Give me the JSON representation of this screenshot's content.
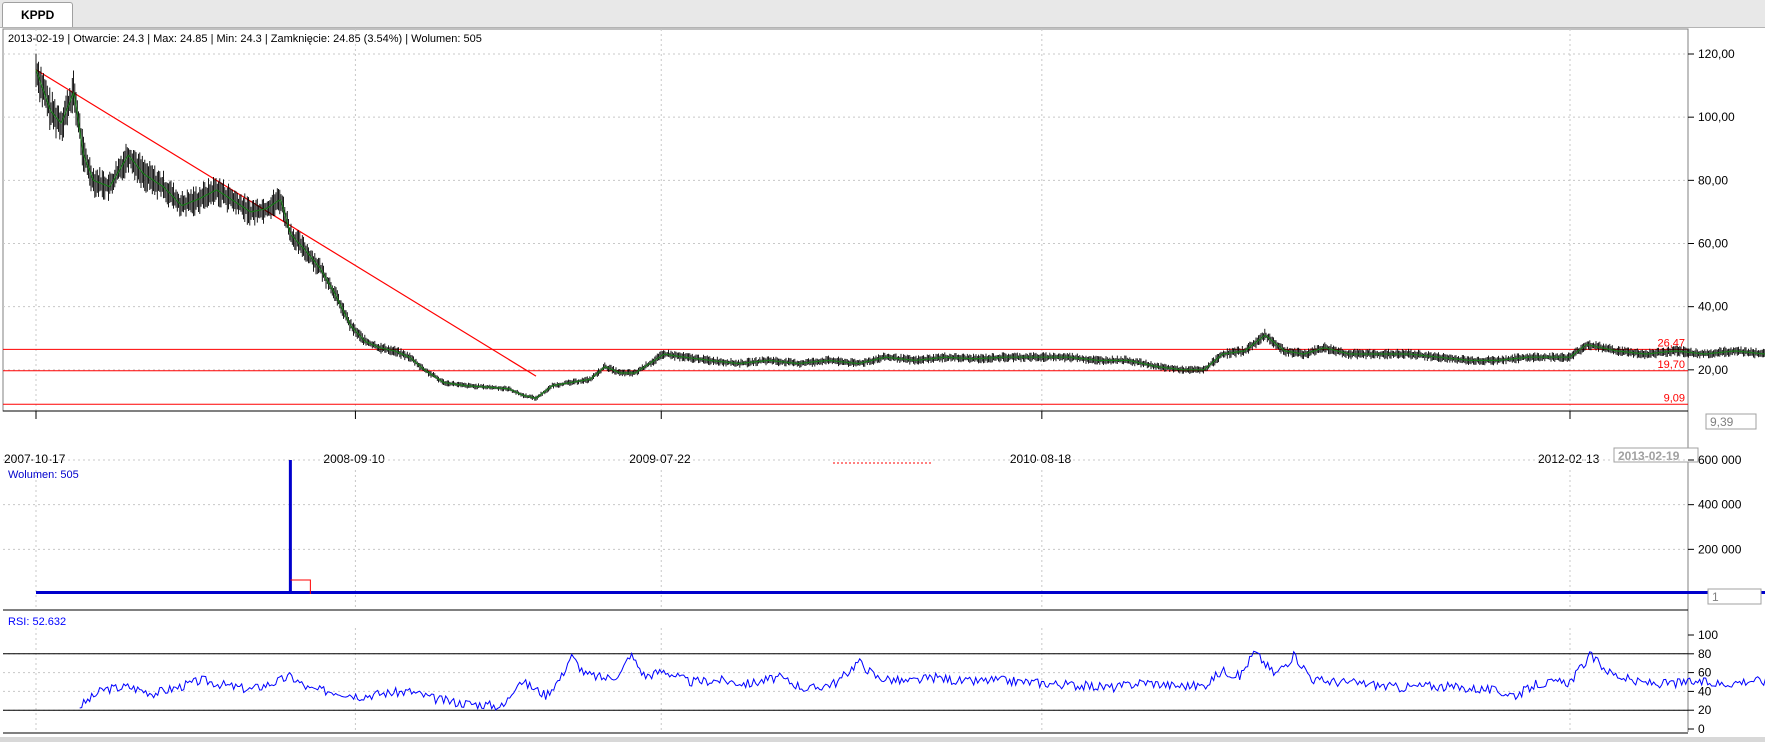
{
  "window": {
    "tab_label": "KPPD"
  },
  "info": {
    "text": "2013-02-19 | Otwarcie: 24.3 | Max: 24.85 | Min: 24.3 | Zamknięcie: 24.85 (3.54%)  | Wolumen: 505"
  },
  "colors": {
    "candles": "#000000",
    "moving_average": "#1a7a1a",
    "trend_lines": "#ff0000",
    "volume": "#0000cc",
    "rsi": "#0000ff"
  },
  "chart_data": [
    {
      "type": "line",
      "name": "price",
      "x_range": [
        "2007-10-17",
        "2013-02-19"
      ],
      "ylim": [
        0,
        120
      ],
      "y_ticks": [
        "120,00",
        "100,00",
        "80,00",
        "60,00",
        "40,00",
        "20,00"
      ],
      "x_ticks": [
        "2007-10-17",
        "2008-09-10",
        "2009-07-22",
        "2010-08-18",
        "2012-02-13"
      ],
      "last_date_label": "2013-02-19",
      "price_marker": "9,39",
      "levels": [
        {
          "value": 26.47,
          "label": "26,47"
        },
        {
          "value": 19.7,
          "label": "19,70"
        },
        {
          "value": 9.09,
          "label": "9,09"
        }
      ],
      "trend_line": [
        {
          "x": "2007-10-17",
          "y": 115
        },
        {
          "x": "2009-03-15",
          "y": 18
        }
      ],
      "close_series": [
        [
          "2007-10-17",
          115
        ],
        [
          "2007-11-01",
          102
        ],
        [
          "2007-11-12",
          98
        ],
        [
          "2007-11-25",
          108
        ],
        [
          "2007-12-05",
          88
        ],
        [
          "2007-12-15",
          80
        ],
        [
          "2008-01-01",
          78
        ],
        [
          "2008-01-20",
          88
        ],
        [
          "2008-02-05",
          82
        ],
        [
          "2008-02-25",
          78
        ],
        [
          "2008-03-15",
          72
        ],
        [
          "2008-04-01",
          74
        ],
        [
          "2008-04-20",
          77
        ],
        [
          "2008-05-10",
          73
        ],
        [
          "2008-05-25",
          70
        ],
        [
          "2008-06-10",
          71
        ],
        [
          "2008-06-25",
          74
        ],
        [
          "2008-07-05",
          63
        ],
        [
          "2008-07-20",
          58
        ],
        [
          "2008-08-05",
          52
        ],
        [
          "2008-08-20",
          44
        ],
        [
          "2008-09-05",
          34
        ],
        [
          "2008-09-20",
          29
        ],
        [
          "2008-10-05",
          27
        ],
        [
          "2008-10-20",
          26
        ],
        [
          "2008-11-05",
          24
        ],
        [
          "2008-11-20",
          20
        ],
        [
          "2008-12-10",
          16
        ],
        [
          "2009-01-01",
          15
        ],
        [
          "2009-01-25",
          14.5
        ],
        [
          "2009-02-15",
          14
        ],
        [
          "2009-03-01",
          12
        ],
        [
          "2009-03-15",
          11
        ],
        [
          "2009-04-01",
          15
        ],
        [
          "2009-04-20",
          16
        ],
        [
          "2009-05-10",
          17
        ],
        [
          "2009-05-25",
          21
        ],
        [
          "2009-06-10",
          19
        ],
        [
          "2009-06-25",
          19
        ],
        [
          "2009-07-10",
          22
        ],
        [
          "2009-07-25",
          25
        ],
        [
          "2009-08-15",
          24
        ],
        [
          "2009-09-10",
          23
        ],
        [
          "2009-10-10",
          22
        ],
        [
          "2009-11-10",
          23
        ],
        [
          "2009-12-10",
          22
        ],
        [
          "2010-01-10",
          23
        ],
        [
          "2010-02-10",
          22
        ],
        [
          "2010-03-10",
          24
        ],
        [
          "2010-04-10",
          23
        ],
        [
          "2010-05-10",
          24
        ],
        [
          "2010-06-10",
          23.5
        ],
        [
          "2010-07-10",
          24
        ],
        [
          "2010-08-18",
          24
        ],
        [
          "2010-09-15",
          24
        ],
        [
          "2010-10-15",
          23
        ],
        [
          "2010-11-15",
          23
        ],
        [
          "2010-12-15",
          21
        ],
        [
          "2011-01-10",
          20
        ],
        [
          "2011-02-01",
          20
        ],
        [
          "2011-02-20",
          25
        ],
        [
          "2011-03-15",
          26
        ],
        [
          "2011-04-05",
          31
        ],
        [
          "2011-04-25",
          26
        ],
        [
          "2011-05-15",
          25
        ],
        [
          "2011-06-05",
          27
        ],
        [
          "2011-07-01",
          25
        ],
        [
          "2011-08-01",
          25
        ],
        [
          "2011-09-01",
          25
        ],
        [
          "2011-10-01",
          24
        ],
        [
          "2011-11-01",
          23
        ],
        [
          "2011-12-01",
          23
        ],
        [
          "2012-01-01",
          24
        ],
        [
          "2012-02-13",
          24
        ],
        [
          "2012-03-01",
          28
        ],
        [
          "2012-04-01",
          26
        ],
        [
          "2012-05-01",
          25
        ],
        [
          "2012-06-01",
          26
        ],
        [
          "2012-07-01",
          25
        ],
        [
          "2012-08-01",
          26
        ],
        [
          "2012-09-01",
          25
        ],
        [
          "2012-10-01",
          25
        ],
        [
          "2012-11-01",
          24
        ],
        [
          "2012-12-01",
          24
        ],
        [
          "2013-01-10",
          25
        ],
        [
          "2013-02-19",
          24.85
        ]
      ]
    },
    {
      "type": "bar",
      "name": "volume",
      "title": "Wolumen: 505",
      "ylim": [
        0,
        600000
      ],
      "y_ticks": [
        "600 000",
        "400 000",
        "200 000"
      ],
      "current_value_marker": "1",
      "spike": {
        "x": "2008-07-05",
        "value": 600000
      },
      "baseline_value": 8000
    },
    {
      "type": "line",
      "name": "RSI",
      "title": "RSI: 52.632",
      "ylim": [
        0,
        100
      ],
      "y_ticks": [
        "100",
        "80",
        "60",
        "40",
        "20",
        "0"
      ],
      "reference_lines": [
        80,
        20
      ],
      "series": [
        [
          "2007-12-01",
          24
        ],
        [
          "2007-12-25",
          42
        ],
        [
          "2008-01-20",
          45
        ],
        [
          "2008-02-15",
          38
        ],
        [
          "2008-03-10",
          44
        ],
        [
          "2008-04-05",
          52
        ],
        [
          "2008-05-01",
          46
        ],
        [
          "2008-05-25",
          42
        ],
        [
          "2008-06-20",
          50
        ],
        [
          "2008-07-05",
          56
        ],
        [
          "2008-07-25",
          42
        ],
        [
          "2008-08-20",
          40
        ],
        [
          "2008-09-15",
          35
        ],
        [
          "2008-10-10",
          38
        ],
        [
          "2008-11-05",
          40
        ],
        [
          "2008-12-01",
          32
        ],
        [
          "2008-12-25",
          28
        ],
        [
          "2009-01-20",
          26
        ],
        [
          "2009-02-10",
          24
        ],
        [
          "2009-02-25",
          52
        ],
        [
          "2009-03-10",
          45
        ],
        [
          "2009-03-25",
          36
        ],
        [
          "2009-04-10",
          55
        ],
        [
          "2009-04-20",
          78
        ],
        [
          "2009-05-05",
          58
        ],
        [
          "2009-05-25",
          54
        ],
        [
          "2009-06-10",
          58
        ],
        [
          "2009-06-20",
          80
        ],
        [
          "2009-07-05",
          56
        ],
        [
          "2009-07-25",
          62
        ],
        [
          "2009-08-20",
          50
        ],
        [
          "2009-09-20",
          52
        ],
        [
          "2009-10-20",
          48
        ],
        [
          "2009-11-20",
          55
        ],
        [
          "2009-12-20",
          42
        ],
        [
          "2010-01-20",
          50
        ],
        [
          "2010-02-10",
          72
        ],
        [
          "2010-03-01",
          55
        ],
        [
          "2010-04-01",
          50
        ],
        [
          "2010-05-01",
          55
        ],
        [
          "2010-06-01",
          50
        ],
        [
          "2010-07-01",
          52
        ],
        [
          "2010-08-01",
          50
        ],
        [
          "2010-09-01",
          48
        ],
        [
          "2010-10-01",
          46
        ],
        [
          "2010-11-01",
          44
        ],
        [
          "2010-12-01",
          50
        ],
        [
          "2011-01-01",
          46
        ],
        [
          "2011-02-01",
          46
        ],
        [
          "2011-02-20",
          62
        ],
        [
          "2011-03-10",
          56
        ],
        [
          "2011-03-25",
          82
        ],
        [
          "2011-04-15",
          58
        ],
        [
          "2011-05-05",
          78
        ],
        [
          "2011-05-25",
          52
        ],
        [
          "2011-06-20",
          50
        ],
        [
          "2011-07-20",
          48
        ],
        [
          "2011-08-20",
          44
        ],
        [
          "2011-09-20",
          46
        ],
        [
          "2011-10-20",
          44
        ],
        [
          "2011-11-20",
          42
        ],
        [
          "2011-12-20",
          36
        ],
        [
          "2012-01-10",
          48
        ],
        [
          "2012-02-13",
          50
        ],
        [
          "2012-03-05",
          78
        ],
        [
          "2012-03-25",
          60
        ],
        [
          "2012-04-20",
          50
        ],
        [
          "2012-05-20",
          48
        ],
        [
          "2012-06-20",
          50
        ],
        [
          "2012-07-20",
          48
        ],
        [
          "2012-08-20",
          52
        ],
        [
          "2012-09-20",
          48
        ],
        [
          "2012-10-20",
          50
        ],
        [
          "2012-11-20",
          48
        ],
        [
          "2012-12-20",
          52
        ],
        [
          "2013-01-20",
          48
        ],
        [
          "2013-02-10",
          52
        ],
        [
          "2013-02-19",
          46
        ]
      ]
    }
  ]
}
